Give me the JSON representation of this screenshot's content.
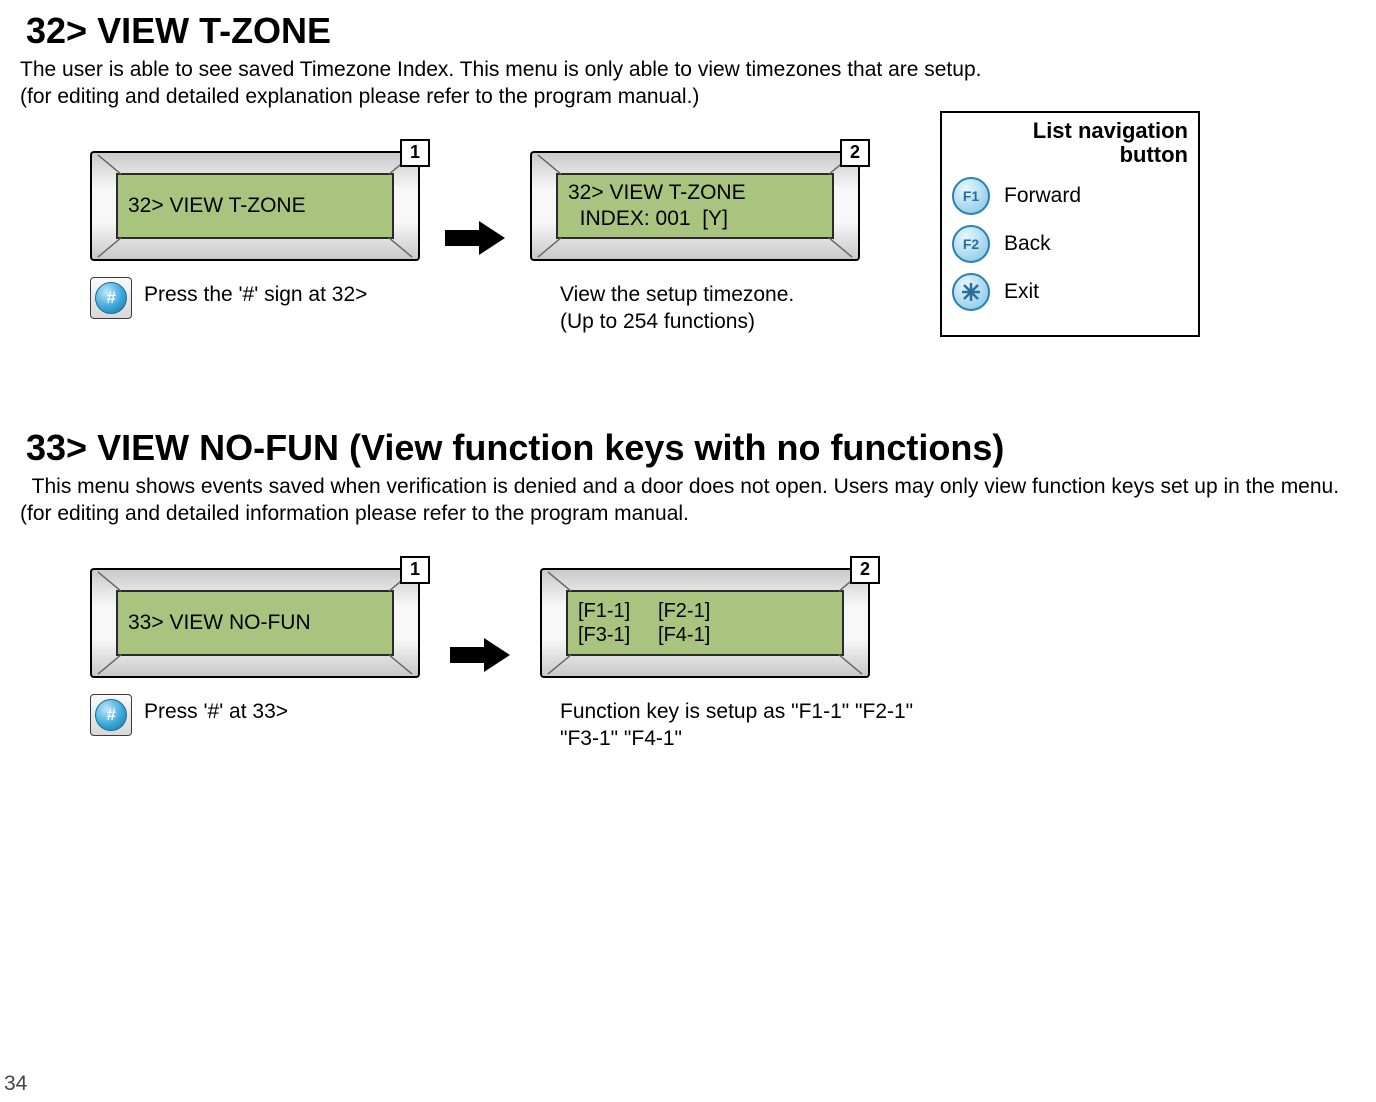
{
  "page_number": "34",
  "section32": {
    "heading": "32> VIEW T-ZONE",
    "desc_line1": "The user is able to see saved Timezone Index. This menu is only able to view timezones that are setup.",
    "desc_line2": " (for editing and detailed explanation please refer to the program manual.)",
    "step1": {
      "badge": "1",
      "lcd_line1": "32> VIEW T-ZONE",
      "caption": "Press the '#' sign at 32>"
    },
    "step2": {
      "badge": "2",
      "lcd_line1": "32> VIEW T-ZONE",
      "lcd_line2": "  INDEX: 001  [Y]",
      "caption_line1": "View the setup timezone.",
      "caption_line2": "(Up to 254 functions)"
    }
  },
  "navbox": {
    "title_line1": "List navigation",
    "title_line2": "button",
    "f1": {
      "label": "F1",
      "text": "Forward"
    },
    "f2": {
      "label": "F2",
      "text": "Back"
    },
    "exit": {
      "text": "Exit"
    }
  },
  "section33": {
    "heading": "33> VIEW NO-FUN (View function keys with no functions)",
    "desc": "  This menu shows events saved when verification is denied and a door does not open. Users may only view function keys set up in the menu. (for editing and detailed information please refer to the program manual.",
    "step1": {
      "badge": "1",
      "lcd_line1": "33> VIEW NO-FUN",
      "caption": "Press '#' at 33>"
    },
    "step2": {
      "badge": "2",
      "lcd_line1": "[F1-1]     [F2-1]",
      "lcd_line2": "[F3-1]     [F4-1]",
      "caption": "Function key is setup as \"F1-1\" \"F2-1\" \"F3-1\" \"F4-1\""
    }
  }
}
